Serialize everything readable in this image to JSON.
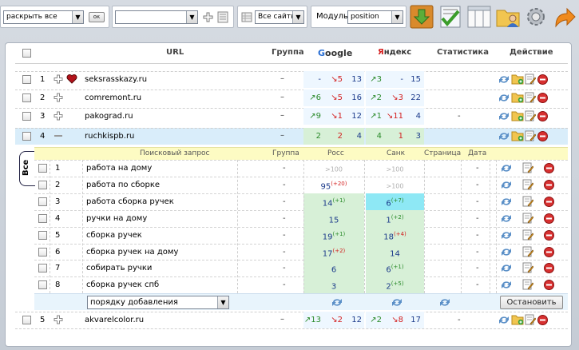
{
  "toolbar": {
    "expand_select": "раскрыть все",
    "ok_label": "ок",
    "group_select": "",
    "sites_select": "Все сайты",
    "modul_label": "Модуль",
    "modul_select": "position"
  },
  "table": {
    "headers": {
      "url": "URL",
      "group": "Группа",
      "google_letters": [
        "G",
        "o",
        "o",
        "g",
        "l",
        "e"
      ],
      "yandex_first": "Я",
      "yandex_rest": "ндекс",
      "stats": "Статистика",
      "action": "Действие"
    },
    "sites": [
      {
        "n": "1",
        "url": "seksrasskazy.ru",
        "group": "–",
        "g1": "-",
        "g2": "↘5",
        "g3": "13",
        "y1": "↗3",
        "y2": "-",
        "y3": "15",
        "stat": ""
      },
      {
        "n": "2",
        "url": "comremont.ru",
        "group": "–",
        "g1": "↗6",
        "g2": "↘5",
        "g3": "16",
        "y1": "↗2",
        "y2": "↘3",
        "y3": "22",
        "stat": ""
      },
      {
        "n": "3",
        "url": "pakograd.ru",
        "group": "–",
        "g1": "↗9",
        "g2": "↘1",
        "g3": "12",
        "y1": "↗1",
        "y2": "↘11",
        "y3": "4",
        "stat": "-"
      },
      {
        "n": "4",
        "url": "ruchkispb.ru",
        "group": "–",
        "g1": "2",
        "g2": "2",
        "g3": "4",
        "y1": "4",
        "y2": "1",
        "y3": "3",
        "stat": ""
      },
      {
        "n": "5",
        "url": "akvarelcolor.ru",
        "group": "–",
        "g1": "↗13",
        "g2": "↘2",
        "g3": "12",
        "y1": "↗2",
        "y2": "↘8",
        "y3": "17",
        "stat": "-"
      }
    ],
    "sub_headers": {
      "query": "Поисковый запрос",
      "group": "Группа",
      "ross": "Росс",
      "sankt": "Санк",
      "page": "Страница",
      "date": "Дата"
    },
    "tab_label": "Все",
    "keywords": [
      {
        "n": "1",
        "kw": "работа на дому",
        "group": "-",
        "ross": ">100",
        "ross_d": "",
        "sankt": ">100",
        "sankt_d": "",
        "page": "",
        "date": "-"
      },
      {
        "n": "2",
        "kw": "работа по сборке",
        "group": "-",
        "ross": "95",
        "ross_d": "(+20)",
        "sankt": ">100",
        "sankt_d": "",
        "page": "",
        "date": "-"
      },
      {
        "n": "3",
        "kw": "работа сборка ручек",
        "group": "-",
        "ross": "14",
        "ross_d": "(+1)",
        "sankt": "6",
        "sankt_d": "(+7)",
        "page": "",
        "date": "-"
      },
      {
        "n": "4",
        "kw": "ручки на дому",
        "group": "-",
        "ross": "15",
        "ross_d": "",
        "sankt": "1",
        "sankt_d": "(+2)",
        "page": "",
        "date": "-"
      },
      {
        "n": "5",
        "kw": "сборка ручек",
        "group": "-",
        "ross": "19",
        "ross_d": "(+1)",
        "sankt": "18",
        "sankt_d": "(+4)",
        "page": "",
        "date": "-"
      },
      {
        "n": "6",
        "kw": "сборка ручек на дому",
        "group": "-",
        "ross": "17",
        "ross_d": "(+2)",
        "sankt": "14",
        "sankt_d": "",
        "page": "",
        "date": "-"
      },
      {
        "n": "7",
        "kw": "собирать ручки",
        "group": "-",
        "ross": "6",
        "ross_d": "",
        "sankt": "6",
        "sankt_d": "(+1)",
        "page": "",
        "date": "-"
      },
      {
        "n": "8",
        "kw": "сборка ручек спб",
        "group": "-",
        "ross": "3",
        "ross_d": "",
        "sankt": "2",
        "sankt_d": "(+5)",
        "page": "",
        "date": "-"
      }
    ],
    "sort_select": "порядку добавления",
    "stop_button": "Остановить"
  }
}
